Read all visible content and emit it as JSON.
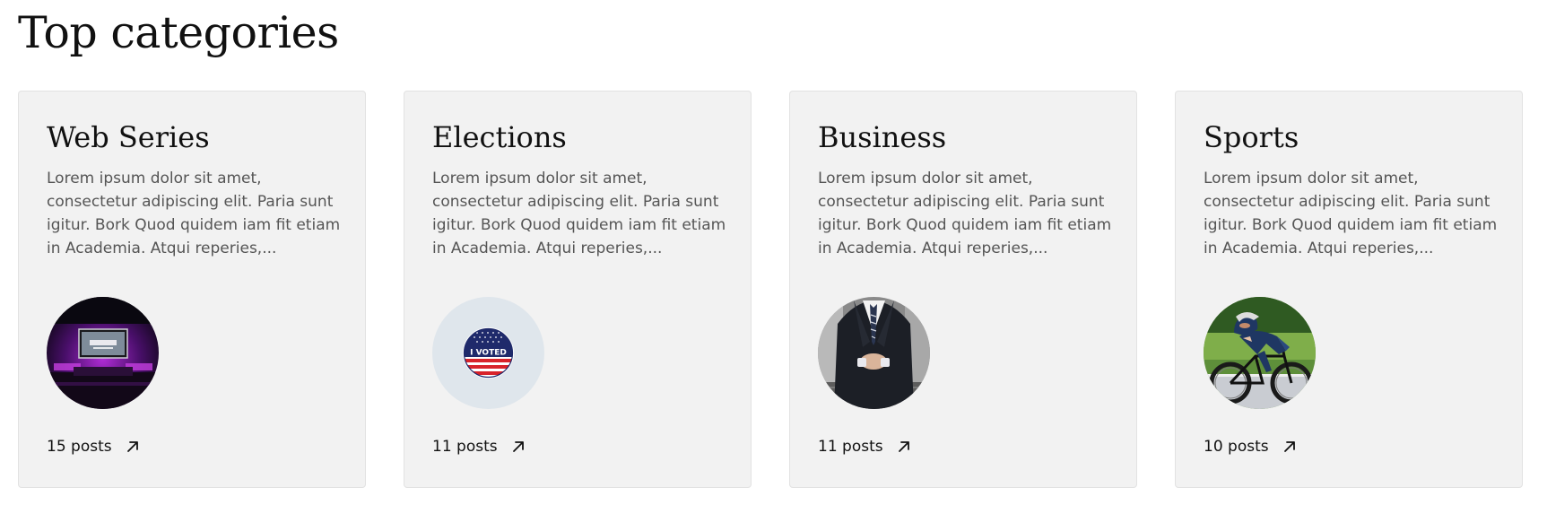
{
  "section": {
    "title": "Top categories"
  },
  "categories": [
    {
      "name": "Web Series",
      "description": "Lorem ipsum dolor sit amet, consectetur adipiscing elit. Paria sunt igitur. Bork Quod quidem iam fit etiam in Academia. Atqui reperies,...",
      "posts": "15 posts",
      "image": "gaming-room-with-tv"
    },
    {
      "name": "Elections",
      "description": "Lorem ipsum dolor sit amet, consectetur adipiscing elit. Paria sunt igitur. Bork Quod quidem iam fit etiam in Academia. Atqui reperies,...",
      "posts": "11 posts",
      "image": "i-voted-sticker",
      "sticker_text": "I VOTED"
    },
    {
      "name": "Business",
      "description": "Lorem ipsum dolor sit amet, consectetur adipiscing elit. Paria sunt igitur. Bork Quod quidem iam fit etiam in Academia. Atqui reperies,...",
      "posts": "11 posts",
      "image": "man-in-suit"
    },
    {
      "name": "Sports",
      "description": "Lorem ipsum dolor sit amet, consectetur adipiscing elit. Paria sunt igitur. Bork Quod quidem iam fit etiam in Academia. Atqui reperies,...",
      "posts": "10 posts",
      "image": "road-cyclist"
    }
  ],
  "icons": {
    "footer_link": "arrow-up-right-icon"
  },
  "colors": {
    "card_background": "#f2f2f2",
    "card_border": "#e2e2e2",
    "title_text": "#111111",
    "body_text": "#555555"
  }
}
